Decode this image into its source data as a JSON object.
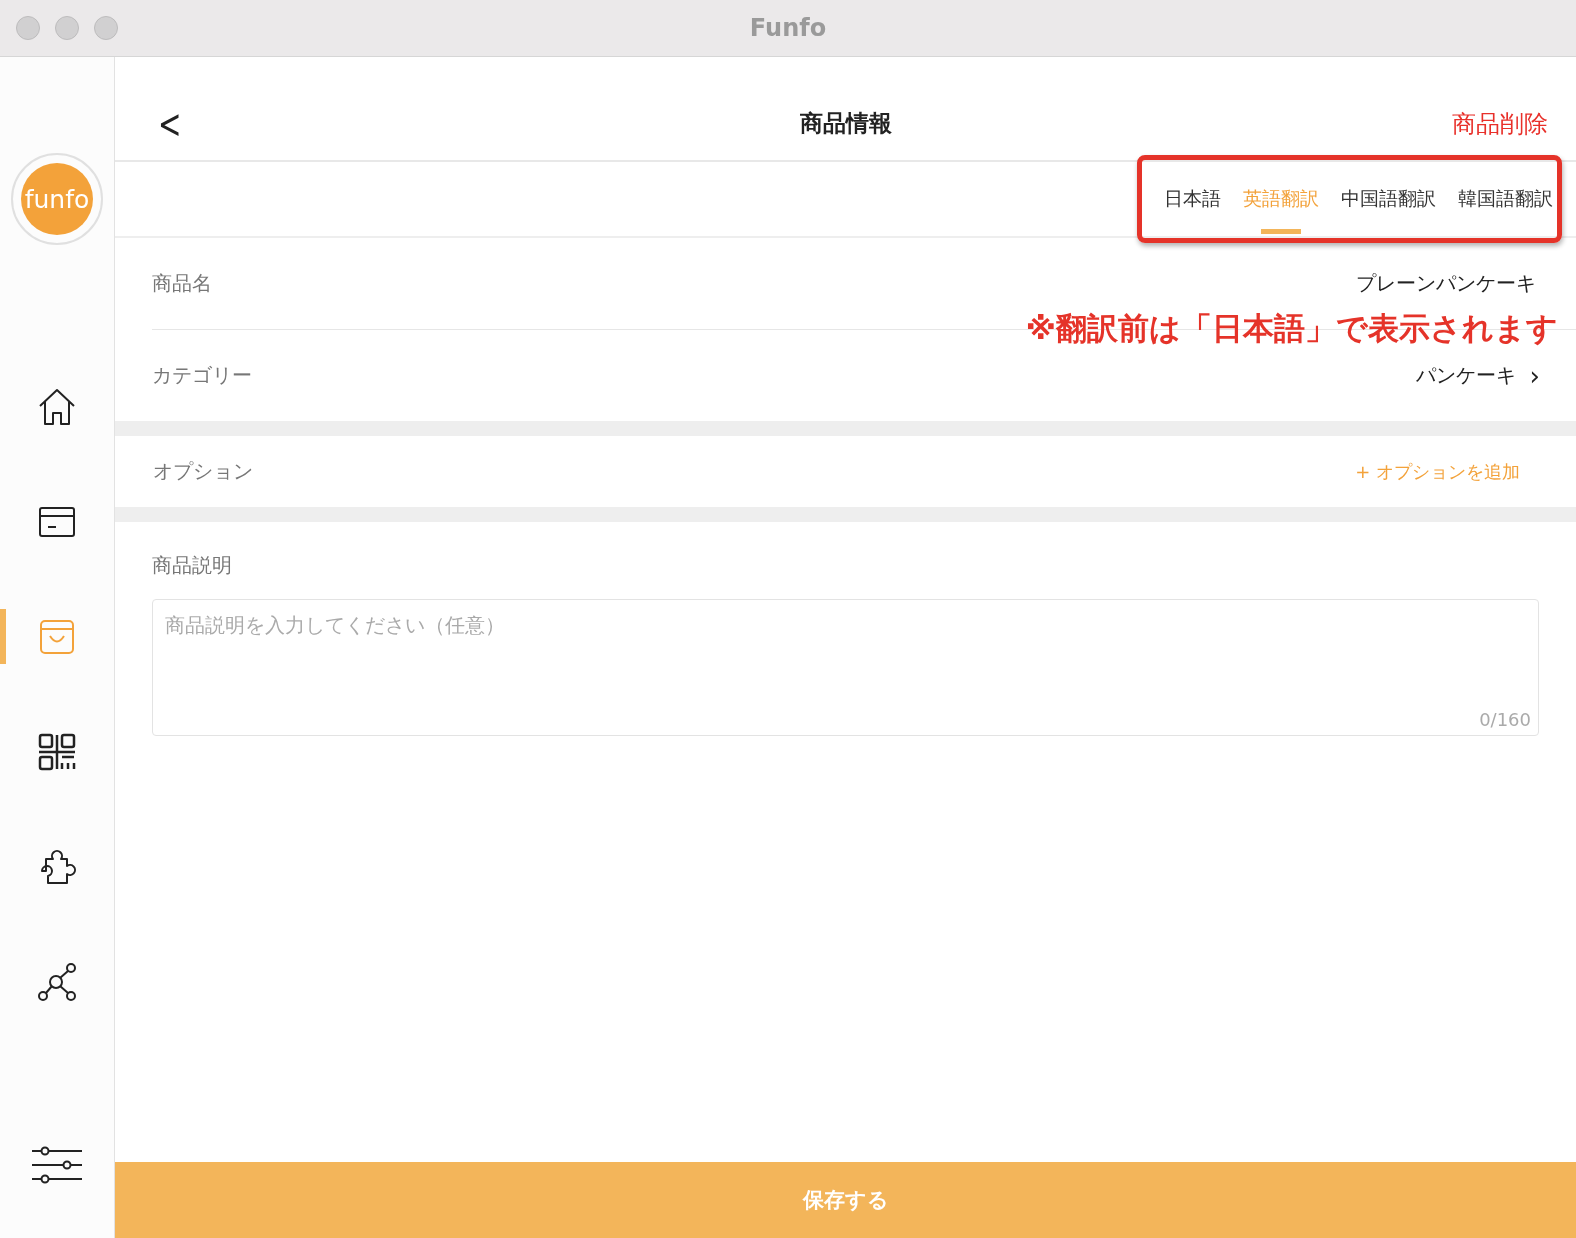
{
  "window": {
    "title": "Funfo"
  },
  "sidebar": {
    "logo": "funfo",
    "items": [
      {
        "kind": "home",
        "selected": false
      },
      {
        "kind": "card",
        "selected": false
      },
      {
        "kind": "bag",
        "selected": true
      },
      {
        "kind": "qr",
        "selected": false
      },
      {
        "kind": "puzzle",
        "selected": false
      },
      {
        "kind": "network",
        "selected": false
      }
    ],
    "footer_item": {
      "kind": "sliders",
      "selected": false
    }
  },
  "header": {
    "back": "<",
    "title": "商品情報",
    "delete": "商品削除"
  },
  "tabs": [
    {
      "label": "日本語",
      "selected": false
    },
    {
      "label": "英語翻訳",
      "selected": true
    },
    {
      "label": "中国語翻訳",
      "selected": false
    },
    {
      "label": "韓国語翻訳",
      "selected": false
    }
  ],
  "annotation": "※翻訳前は「日本語」で表示されます",
  "fields": [
    {
      "label": "商品名",
      "value": "プレーンパンケーキ"
    },
    {
      "label": "カテゴリー",
      "value": "パンケーキ",
      "chevron": "›"
    }
  ],
  "option": {
    "label": "オプション",
    "action": "+ オプションを追加"
  },
  "description": {
    "label": "商品説明",
    "placeholder": "商品説明を入力してください（任意）",
    "counter": "0/160"
  },
  "save": "保存する"
}
